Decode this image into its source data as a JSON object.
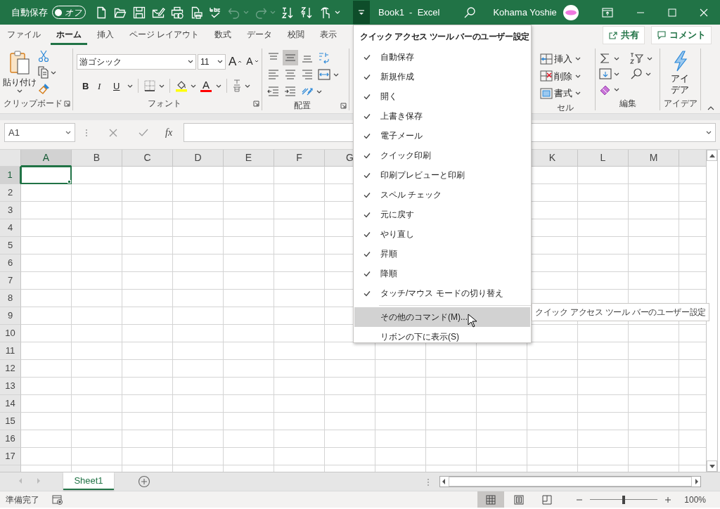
{
  "title_bar": {
    "autosave": {
      "label": "自動保存",
      "on": false,
      "state_label": "オフ"
    },
    "quick_access": [
      {
        "kind": "new",
        "disabled": false
      },
      {
        "kind": "open",
        "disabled": false
      },
      {
        "kind": "save",
        "disabled": false
      },
      {
        "kind": "email",
        "disabled": false
      },
      {
        "kind": "quick_print",
        "disabled": false
      },
      {
        "kind": "print_preview",
        "disabled": false
      },
      {
        "kind": "spelling",
        "disabled": false
      },
      {
        "kind": "undo",
        "disabled": true
      },
      {
        "kind": "redo",
        "disabled": true
      },
      {
        "kind": "sort_asc",
        "disabled": false
      },
      {
        "kind": "sort_desc",
        "disabled": false
      },
      {
        "kind": "touch_mode",
        "disabled": false
      }
    ],
    "customize_button": {
      "expanded": true
    },
    "document_title": "Book1  -  Excel",
    "user_name": "Kohama Yoshie"
  },
  "ribbon_tabs": [
    {
      "label": "ファイル",
      "selected": false
    },
    {
      "label": "ホーム",
      "selected": true
    },
    {
      "label": "挿入",
      "selected": false
    },
    {
      "label": "ページ レイアウト",
      "selected": false
    },
    {
      "label": "数式",
      "selected": false
    },
    {
      "label": "データ",
      "selected": false
    },
    {
      "label": "校閲",
      "selected": false
    },
    {
      "label": "表示",
      "selected": false
    }
  ],
  "share_button": "共有",
  "comment_button": "コメント",
  "ribbon": {
    "clipboard": {
      "paste": "貼り付け",
      "label": "クリップボード"
    },
    "font": {
      "font_name": "游ゴシック",
      "font_size": "11",
      "grow": "A",
      "shrink": "A",
      "bold": "B",
      "italic": "I",
      "underline": "U",
      "font_color": "A",
      "label": "フォント"
    },
    "alignment": {
      "buttons": [
        {
          "kind": "top",
          "selected": false
        },
        {
          "kind": "middle",
          "selected": true
        },
        {
          "kind": "bottom",
          "selected": false
        },
        {
          "kind": "wrap",
          "selected": false
        },
        {
          "kind": "left",
          "selected": false
        },
        {
          "kind": "center",
          "selected": false
        },
        {
          "kind": "right",
          "selected": false
        },
        {
          "kind": "merge",
          "selected": false
        },
        {
          "kind": "outdent",
          "selected": false
        },
        {
          "kind": "indent",
          "selected": false
        },
        {
          "kind": "orientation",
          "selected": false
        }
      ],
      "label": "配置"
    },
    "cells": {
      "buttons": [
        {
          "kind": "insert",
          "label": "挿入"
        },
        {
          "kind": "delete",
          "label": "削除"
        },
        {
          "kind": "format",
          "label": "書式"
        }
      ],
      "label": "セル"
    },
    "editing": {
      "label": "編集"
    },
    "ideas": {
      "button": "アイデア",
      "label": "アイデア"
    }
  },
  "formula_bar": {
    "name_box": "A1",
    "function_button": "fx"
  },
  "grid": {
    "columns": [
      {
        "label": "A",
        "selected": true
      },
      {
        "label": "B",
        "selected": false
      },
      {
        "label": "C",
        "selected": false
      },
      {
        "label": "D",
        "selected": false
      },
      {
        "label": "E",
        "selected": false
      },
      {
        "label": "F",
        "selected": false
      },
      {
        "label": "G",
        "selected": false
      },
      {
        "label": "K",
        "selected": false
      },
      {
        "label": "L",
        "selected": false
      },
      {
        "label": "M",
        "selected": false
      }
    ],
    "rows": [
      {
        "label": "1",
        "selected": true
      },
      {
        "label": "2",
        "selected": false
      },
      {
        "label": "3",
        "selected": false
      },
      {
        "label": "4",
        "selected": false
      },
      {
        "label": "5",
        "selected": false
      },
      {
        "label": "6",
        "selected": false
      },
      {
        "label": "7",
        "selected": false
      },
      {
        "label": "8",
        "selected": false
      },
      {
        "label": "9",
        "selected": false
      },
      {
        "label": "10",
        "selected": false
      },
      {
        "label": "11",
        "selected": false
      },
      {
        "label": "12",
        "selected": false
      },
      {
        "label": "13",
        "selected": false
      },
      {
        "label": "14",
        "selected": false
      },
      {
        "label": "15",
        "selected": false
      },
      {
        "label": "16",
        "selected": false
      },
      {
        "label": "17",
        "selected": false
      }
    ]
  },
  "sheet_tabs": [
    {
      "label": "Sheet1",
      "selected": true
    }
  ],
  "status_bar": {
    "status": "準備完了",
    "views": [
      {
        "kind": "normal",
        "selected": true
      },
      {
        "kind": "page_layout",
        "selected": false
      },
      {
        "kind": "page_break",
        "selected": false
      }
    ],
    "zoom": {
      "level": 0.5,
      "reading": "100%"
    }
  },
  "qat_menu": {
    "title": "クイック アクセス ツール バーのユーザー設定",
    "items": [
      {
        "label": "自動保存",
        "checked": true
      },
      {
        "label": "新規作成",
        "checked": true
      },
      {
        "label": "開く",
        "checked": true
      },
      {
        "label": "上書き保存",
        "checked": true
      },
      {
        "label": "電子メール",
        "checked": true
      },
      {
        "label": "クイック印刷",
        "checked": true
      },
      {
        "label": "印刷プレビューと印刷",
        "checked": true
      },
      {
        "label": "スペル チェック",
        "checked": true
      },
      {
        "label": "元に戻す",
        "checked": true
      },
      {
        "label": "やり直し",
        "checked": true
      },
      {
        "label": "昇順",
        "checked": true
      },
      {
        "label": "降順",
        "checked": true
      },
      {
        "label": "タッチ/マウス モードの切り替え",
        "checked": true
      }
    ],
    "commands": [
      {
        "label": "その他のコマンド(M)...",
        "highlighted": true
      },
      {
        "label": "リボンの下に表示(S)",
        "highlighted": false
      }
    ]
  },
  "tooltip": "クイック アクセス ツール バーのユーザー設定"
}
